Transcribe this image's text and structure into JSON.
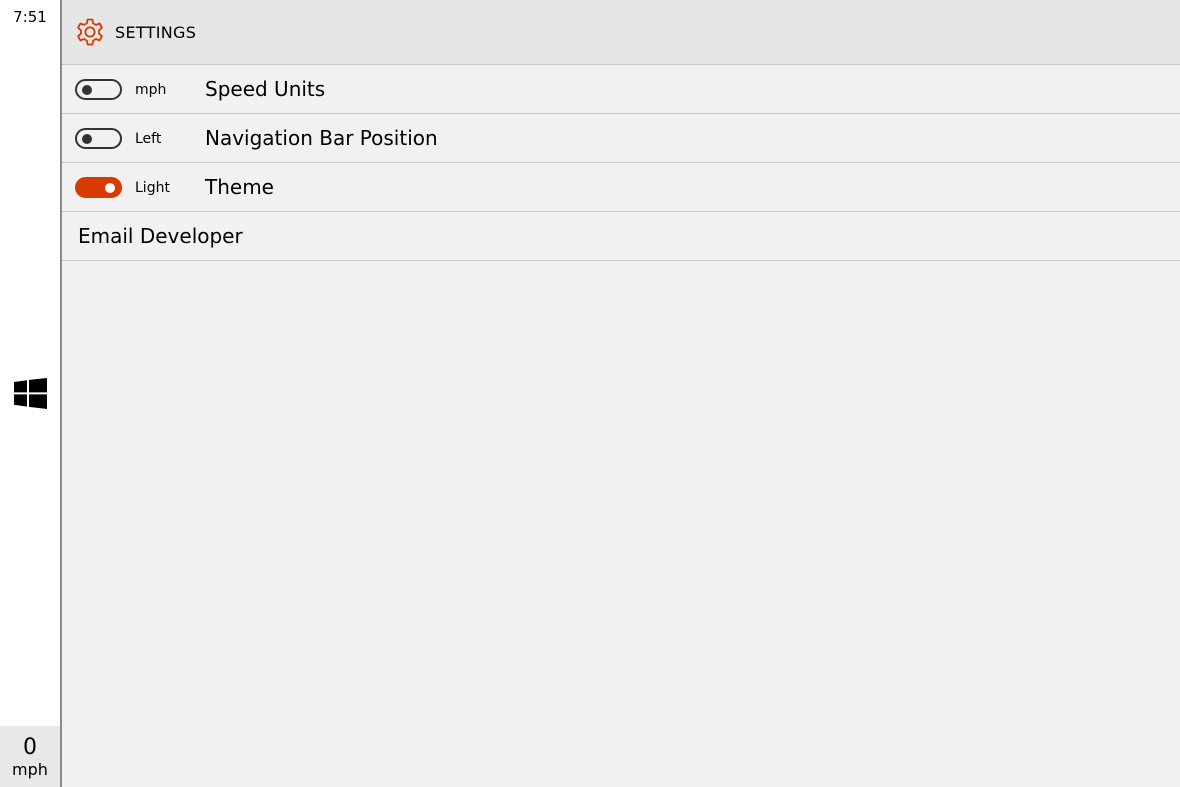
{
  "nav": {
    "time": "7:51",
    "windows_icon": "windows-logo-icon",
    "speed": {
      "value": "0",
      "unit": "mph"
    }
  },
  "header": {
    "icon": "gear-icon",
    "title": "SETTINGS"
  },
  "settings": {
    "items": [
      {
        "state_text": "mph",
        "label": "Speed Units",
        "on": false
      },
      {
        "state_text": "Left",
        "label": "Navigation Bar Position",
        "on": false
      },
      {
        "state_text": "Light",
        "label": "Theme",
        "on": true
      }
    ],
    "email_label": "Email Developer"
  },
  "colors": {
    "accent": "#d83b01",
    "panel_bg": "#f1f1f1",
    "header_bg": "#e6e6e6",
    "nav_bg": "#ffffff",
    "speed_bg": "#e8e8e8"
  }
}
